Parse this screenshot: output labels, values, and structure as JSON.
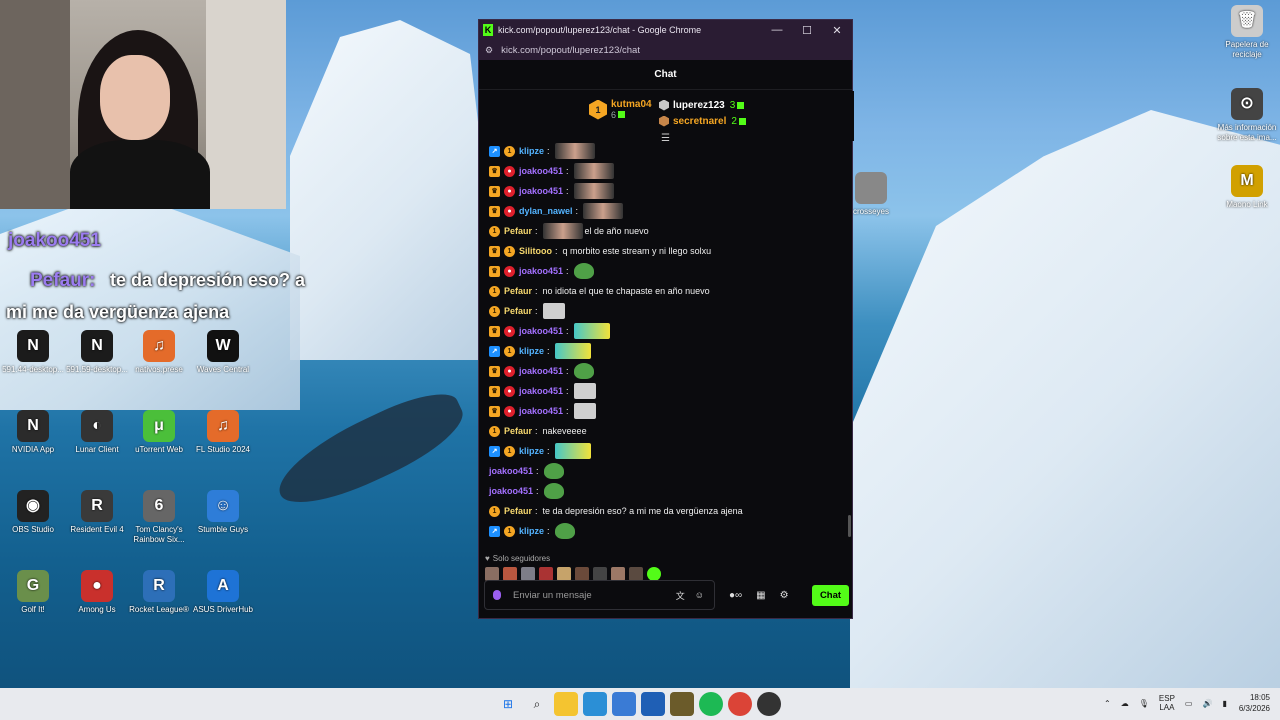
{
  "desktop": {
    "overlay": {
      "user1": "joakoo451",
      "user2": "Pefaur:",
      "msg1": "te da depresión eso? a",
      "msg2": "mi me da vergüenza ajena"
    },
    "icons": [
      {
        "label": "591.44-desktop...",
        "glyph": "N",
        "color": "#1b1b1b"
      },
      {
        "label": "591.59-desktop...",
        "glyph": "N",
        "color": "#1b1b1b"
      },
      {
        "label": "nativos.prese",
        "glyph": "♫",
        "color": "#e46b2a"
      },
      {
        "label": "Waves Central",
        "glyph": "W",
        "color": "#111111"
      },
      {
        "label": "NVIDIA App",
        "glyph": "N",
        "color": "#2b2b2b"
      },
      {
        "label": "Lunar Client",
        "glyph": "◐",
        "color": "#333333"
      },
      {
        "label": "uTorrent Web",
        "glyph": "μ",
        "color": "#4bbf3a"
      },
      {
        "label": "FL Studio 2024",
        "glyph": "♫",
        "color": "#e46b2a"
      },
      {
        "label": "OBS Studio",
        "glyph": "◉",
        "color": "#222222"
      },
      {
        "label": "Resident Evil 4",
        "glyph": "R",
        "color": "#3a3a3a"
      },
      {
        "label": "Tom Clancy's Rainbow Six...",
        "glyph": "6",
        "color": "#666666"
      },
      {
        "label": "Stumble Guys",
        "glyph": "☺",
        "color": "#2e7dd8"
      },
      {
        "label": "Golf It!",
        "glyph": "G",
        "color": "#6a8f4b"
      },
      {
        "label": "Among Us",
        "glyph": "●",
        "color": "#c9302c"
      },
      {
        "label": "Rocket League®",
        "glyph": "R",
        "color": "#2d6fb8"
      },
      {
        "label": "ASUS DriverHub",
        "glyph": "A",
        "color": "#1e73d6"
      },
      {
        "label": "Papelera de reciclaje",
        "glyph": "🗑",
        "color": "#cccccc"
      },
      {
        "label": "Más información sobre esta ima...",
        "glyph": "⊙",
        "color": "#444444"
      },
      {
        "label": "Maono Link",
        "glyph": "M",
        "color": "#d1a000"
      },
      {
        "label": "crosseyes",
        "glyph": "",
        "color": "#888888"
      }
    ]
  },
  "window": {
    "title": "kick.com/popout/luperez123/chat - Google Chrome",
    "url": "kick.com/popout/luperez123/chat",
    "controls": {
      "min": "—",
      "max": "☐",
      "close": "✕"
    }
  },
  "chat": {
    "header": "Chat",
    "leaderboard": {
      "first": {
        "rank": "1",
        "name": "kutma04",
        "count": "6"
      },
      "second": {
        "name": "luperez123",
        "count": "3"
      },
      "third": {
        "name": "secretnarel",
        "count": "2"
      }
    },
    "messages": [
      {
        "badges": [
          "og",
          "sub"
        ],
        "user": "klipze",
        "color": "#53b3ff",
        "text": "",
        "emote": "face"
      },
      {
        "badges": [
          "vip",
          "red"
        ],
        "user": "joakoo451",
        "color": "#a370ff",
        "text": "",
        "emote": "face"
      },
      {
        "badges": [
          "vip",
          "red"
        ],
        "user": "joakoo451",
        "color": "#a370ff",
        "text": "",
        "emote": "face"
      },
      {
        "badges": [
          "vip",
          "red"
        ],
        "user": "dylan_nawel",
        "color": "#53b3ff",
        "text": "",
        "emote": "face"
      },
      {
        "badges": [
          "sub"
        ],
        "user": "Pefaur",
        "color": "#f5d76e",
        "text": "el de año nuevo",
        "emote": "face"
      },
      {
        "badges": [
          "vip",
          "sub"
        ],
        "user": "Silitooo",
        "color": "#f5d76e",
        "text": "q morbito este stream y ni llego solxu",
        "emote": ""
      },
      {
        "badges": [
          "vip",
          "red"
        ],
        "user": "joakoo451",
        "color": "#a370ff",
        "text": "",
        "emote": "pepe"
      },
      {
        "badges": [
          "sub"
        ],
        "user": "Pefaur",
        "color": "#f5d76e",
        "text": "no idiota el que te chapaste en año nuevo",
        "emote": ""
      },
      {
        "badges": [
          "sub"
        ],
        "user": "Pefaur",
        "color": "#f5d76e",
        "text": "",
        "emote": "meme"
      },
      {
        "badges": [
          "vip",
          "red"
        ],
        "user": "joakoo451",
        "color": "#a370ff",
        "text": "",
        "emote": "yellow"
      },
      {
        "badges": [
          "og",
          "sub"
        ],
        "user": "klipze",
        "color": "#53b3ff",
        "text": "",
        "emote": "yellow"
      },
      {
        "badges": [
          "vip",
          "red"
        ],
        "user": "joakoo451",
        "color": "#a370ff",
        "text": "",
        "emote": "pepe"
      },
      {
        "badges": [
          "vip",
          "red"
        ],
        "user": "joakoo451",
        "color": "#a370ff",
        "text": "",
        "emote": "meme"
      },
      {
        "badges": [
          "vip",
          "red"
        ],
        "user": "joakoo451",
        "color": "#a370ff",
        "text": "",
        "emote": "meme"
      },
      {
        "badges": [
          "sub"
        ],
        "user": "Pefaur",
        "color": "#f5d76e",
        "text": "nakeveeee",
        "emote": ""
      },
      {
        "badges": [
          "og",
          "sub"
        ],
        "user": "klipze",
        "color": "#53b3ff",
        "text": "",
        "emote": "yellow"
      },
      {
        "badges": [],
        "user": "joakoo451",
        "color": "#a370ff",
        "text": "",
        "emote": "pepe"
      },
      {
        "badges": [],
        "user": "joakoo451",
        "color": "#a370ff",
        "text": "",
        "emote": "pepe"
      },
      {
        "badges": [
          "sub"
        ],
        "user": "Pefaur",
        "color": "#f5d76e",
        "text": "te da depresión eso? a mi me da vergüenza ajena",
        "emote": ""
      },
      {
        "badges": [
          "og",
          "sub"
        ],
        "user": "klipze",
        "color": "#53b3ff",
        "text": "",
        "emote": "pepe"
      }
    ],
    "followers_label": "Solo seguidores",
    "input_placeholder": "Enviar un mensaje",
    "send_label": "Chat"
  },
  "taskbar": {
    "lang": "ESP",
    "lang2": "LAA",
    "time": "18:05",
    "date": "6/3/2026"
  }
}
